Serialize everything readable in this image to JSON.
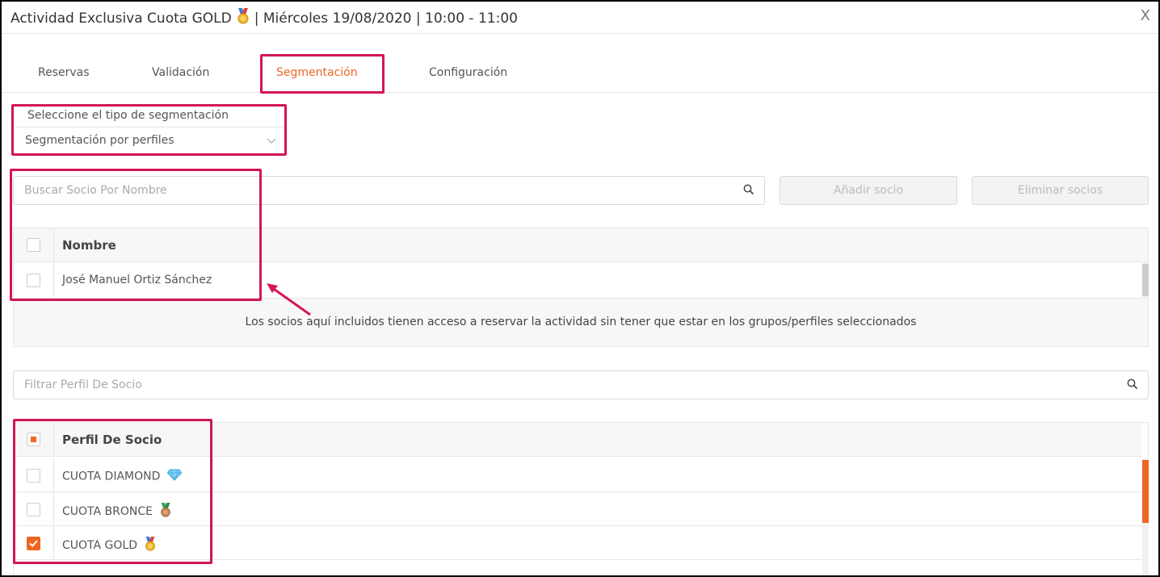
{
  "header": {
    "title_before": "Actividad Exclusiva Cuota GOLD",
    "title_after": "| Miércoles 19/08/2020 | 10:00 - 11:00",
    "close_label": "X"
  },
  "tabs": [
    {
      "label": "Reservas",
      "active": false
    },
    {
      "label": "Validación",
      "active": false
    },
    {
      "label": "Segmentación",
      "active": true
    },
    {
      "label": "Configuración",
      "active": false
    }
  ],
  "segmentation": {
    "label": "Seleccione el tipo de segmentación",
    "selected": "Segmentación por perfiles"
  },
  "members": {
    "search_placeholder": "Buscar Socio Por Nombre",
    "add_button": "Añadir socio",
    "remove_button": "Eliminar socios",
    "column_header": "Nombre",
    "rows": [
      "José Manuel Ortiz Sánchez"
    ],
    "note": "Los socios aquí incluidos tienen acceso a reservar la actividad sin tener que estar en los grupos/perfiles seleccionados"
  },
  "profiles": {
    "filter_placeholder": "Filtrar Perfil De Socio",
    "column_header": "Perfil De Socio",
    "rows": [
      {
        "label": "CUOTA DIAMOND",
        "icon": "diamond-icon",
        "checked": false
      },
      {
        "label": "CUOTA BRONCE",
        "icon": "bronze-medal-icon",
        "checked": false
      },
      {
        "label": "CUOTA GOLD",
        "icon": "gold-medal-icon",
        "checked": true
      }
    ]
  },
  "colors": {
    "accent": "#ee6622",
    "highlight": "#d4145a"
  }
}
